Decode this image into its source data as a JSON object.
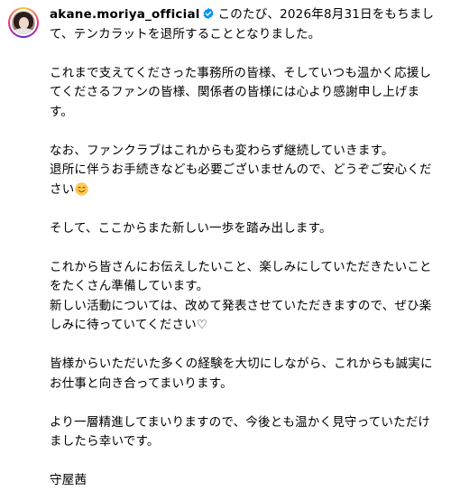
{
  "post": {
    "username": "akane.moriya_official",
    "verified": true,
    "accent_color": "#0095f6",
    "paragraphs": {
      "p1": "このたび、2026年8月31日をもちまして、テンカラットを退所することとなりました。",
      "p2": "これまで支えてくださった事務所の皆様、そしていつも温かく応援してくださるファンの皆様、関係者の皆様には心より感謝申し上げます。",
      "p3": "なお、ファンクラブはこれからも変わらず継続していきます。\n退所に伴うお手続きなども必要ございませんので、どうぞご安心ください",
      "p3_emoji": "smiling-face-emoji",
      "p4": "そして、ここからまた新しい一歩を踏み出します。",
      "p5": "これから皆さんにお伝えしたいこと、楽しみにしていただきたいことをたくさん準備しています。\n新しい活動については、改めて発表させていただきますので、ぜひ楽しみに待っていてください♡",
      "p6": "皆様からいただいた多くの経験を大切にしながら、これからも誠実にお仕事と向き合ってまいります。",
      "p7": "より一層精進してまいりますので、今後とも温かく見守っていただけましたら幸いです。",
      "signature": "守屋茜"
    }
  }
}
